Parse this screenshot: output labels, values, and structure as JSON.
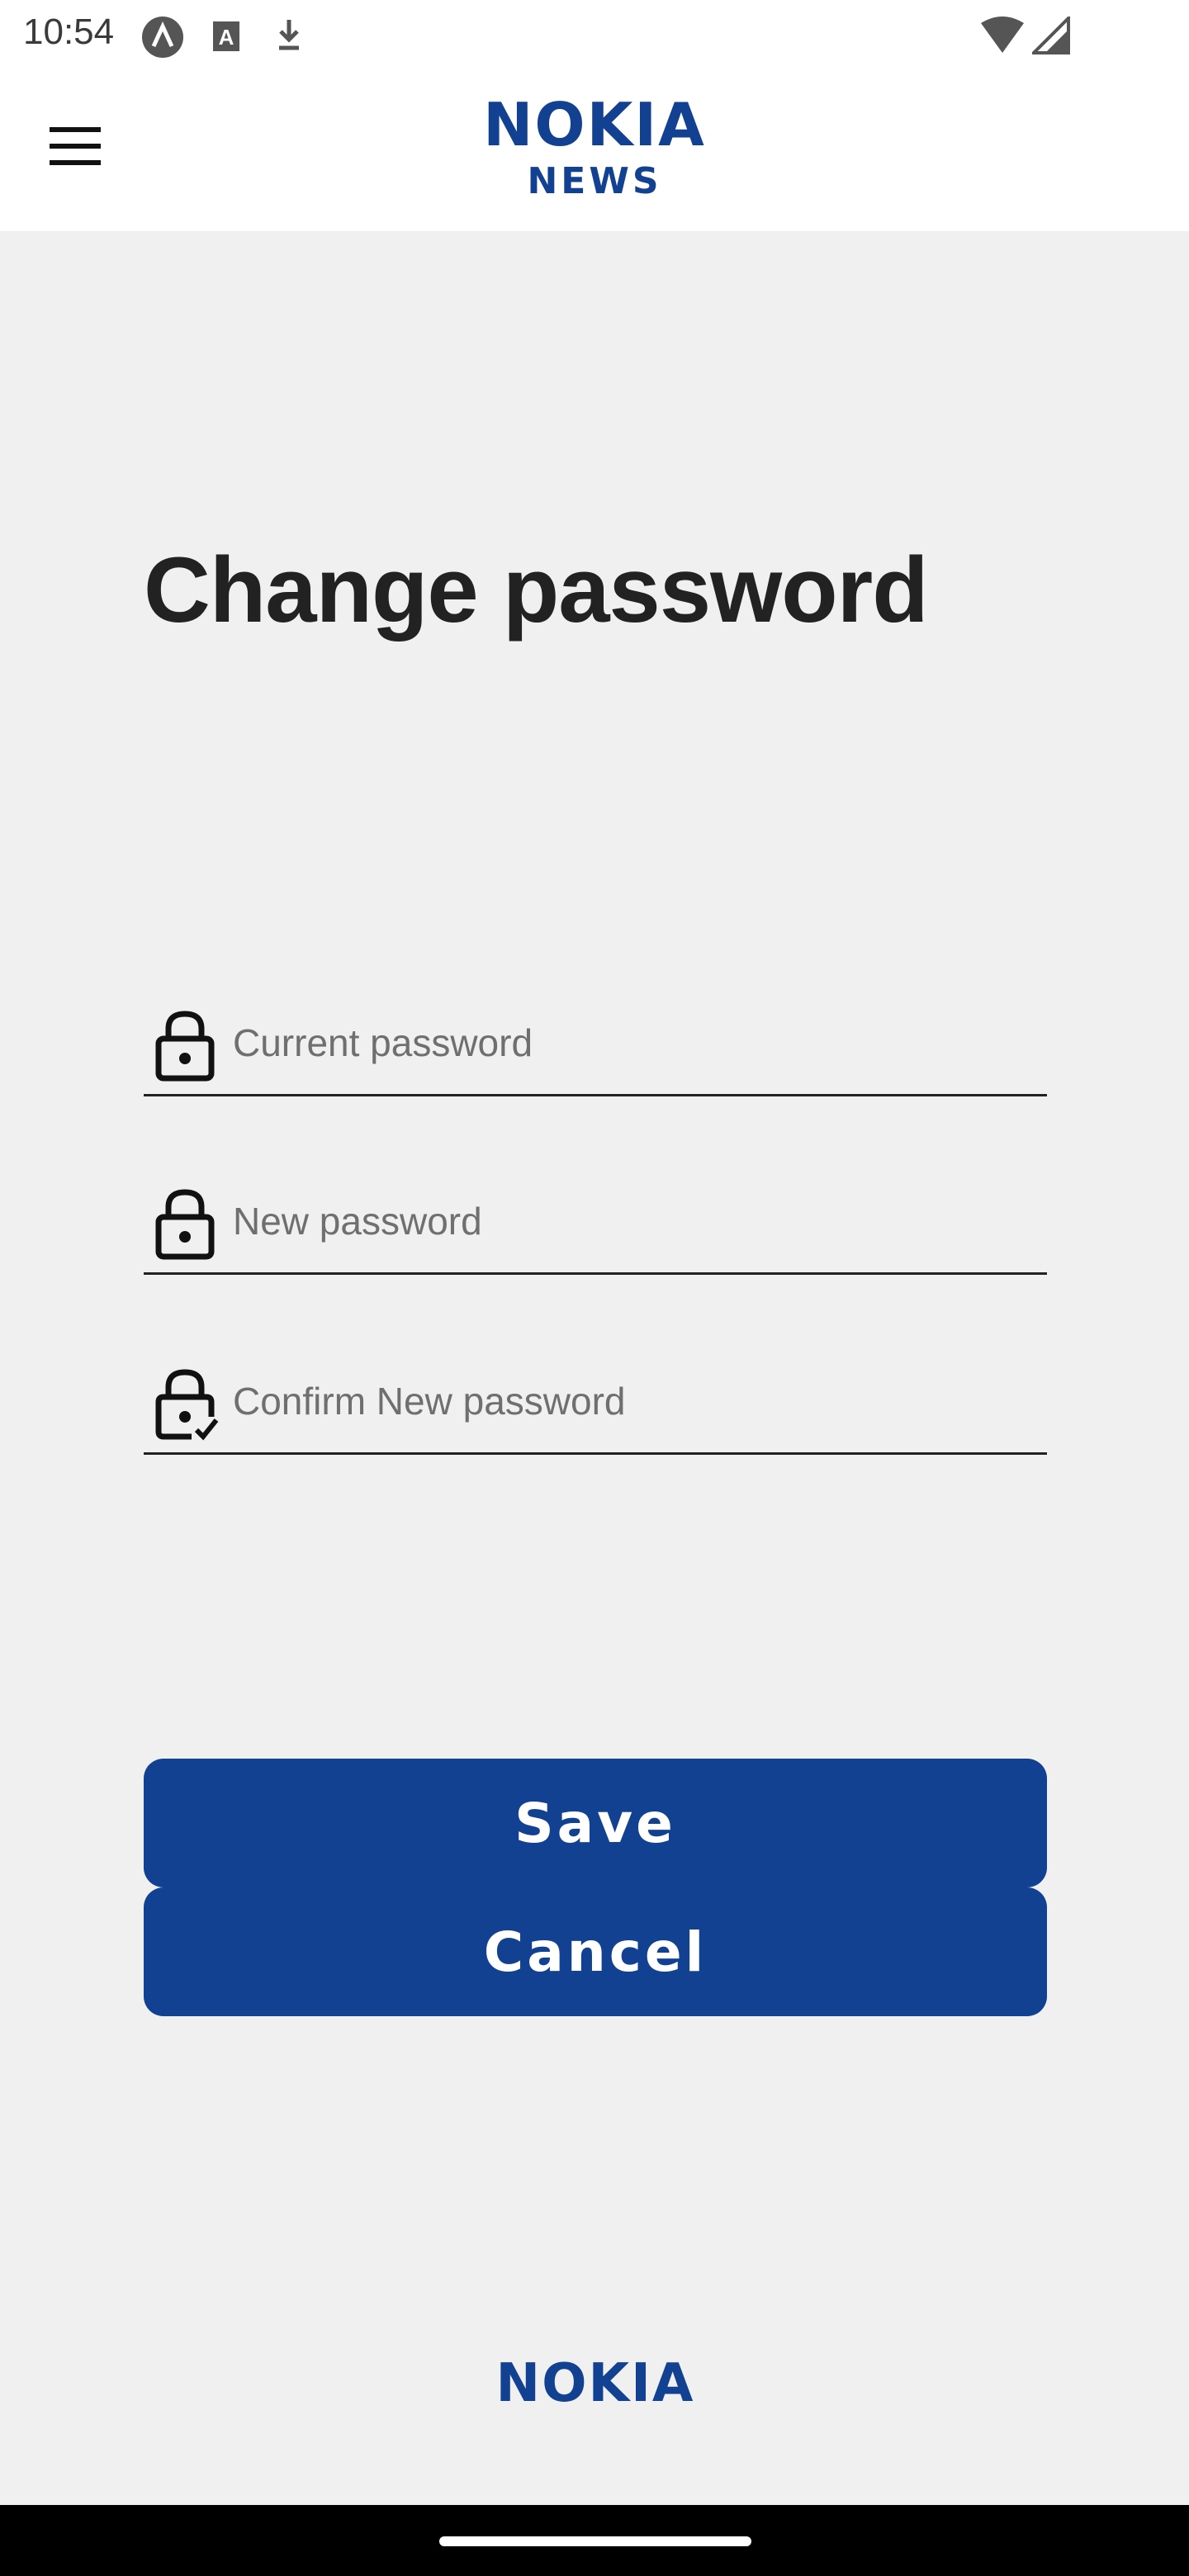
{
  "status_bar": {
    "time": "10:54",
    "icons": [
      "app-notification-icon",
      "text-icon",
      "download-icon",
      "wifi-icon",
      "signal-icon"
    ]
  },
  "header": {
    "menu_icon": "hamburger-menu-icon",
    "logo_top": "NOKIA",
    "logo_bottom": "NEWS"
  },
  "page": {
    "title": "Change password"
  },
  "form": {
    "fields": [
      {
        "placeholder": "Current password",
        "value": "",
        "icon": "lock-icon"
      },
      {
        "placeholder": "New password",
        "value": "",
        "icon": "lock-icon"
      },
      {
        "placeholder": "Confirm New password",
        "value": "",
        "icon": "lock-check-icon"
      }
    ]
  },
  "buttons": {
    "save": "Save",
    "cancel": "Cancel"
  },
  "footer": {
    "logo": "NOKIA"
  },
  "colors": {
    "brand_blue": "#124191",
    "background": "#f0f0f0",
    "header_background": "#ffffff"
  }
}
